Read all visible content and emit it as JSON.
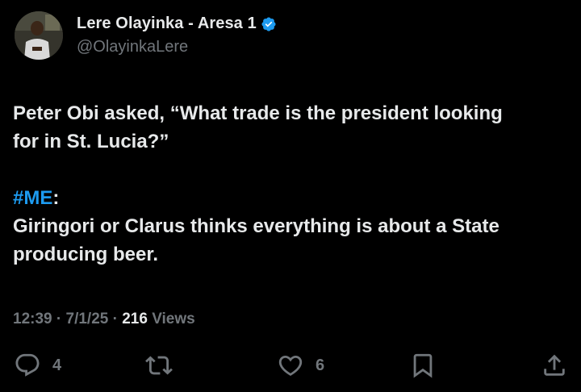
{
  "author": {
    "display_name": "Lere Olayinka - Aresa 1",
    "handle": "@OlayinkaLere",
    "verified": true
  },
  "post": {
    "line1": "Peter Obi asked, “What trade is the president looking",
    "line2": "for in St. Lucia?”",
    "hashtag": "#ME",
    "hashtag_suffix": ":",
    "line4": "Giringori or Clarus thinks everything is about a State",
    "line5": "producing beer."
  },
  "meta": {
    "time": "12:39",
    "sep1": " · ",
    "date": "7/1/25",
    "sep2": " · ",
    "views_count": "216",
    "views_label": " Views"
  },
  "actions": {
    "replies": "4",
    "likes": "6"
  },
  "colors": {
    "background": "#000000",
    "text": "#e7e9ea",
    "secondary": "#71767b",
    "accent": "#1d9bf0"
  },
  "icons": [
    "verified-badge-icon",
    "reply-icon",
    "repost-icon",
    "like-icon",
    "bookmark-icon",
    "share-icon"
  ]
}
